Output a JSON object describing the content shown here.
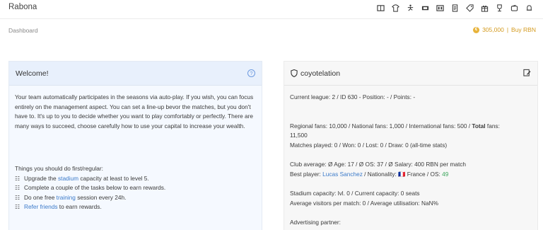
{
  "header": {
    "brand": "Rabona",
    "icons": [
      "scoreboard-icon",
      "shirt-icon",
      "kick-icon",
      "ticket-icon",
      "film-icon",
      "document-icon",
      "tag-icon",
      "gift-icon",
      "trophy-icon",
      "wallet-icon",
      "bell-icon"
    ]
  },
  "subbar": {
    "breadcrumb": "Dashboard",
    "coin_symbol": "€",
    "balance": "305,000",
    "separator": "|",
    "buy_link": "Buy RBN"
  },
  "welcome": {
    "title": "Welcome!",
    "help_symbol": "?",
    "intro": "Your team automatically participates in the seasons via auto-play. If you wish, you can focus entirely on the management aspect. You can set a line-up bevor the matches, but you don't have to. It's up to you to decide whether you want to play comfortably or perfectly. There are many ways to succeed, choose carefully how to use your capital to increase your wealth.",
    "tasks_heading": "Things you should do first/regular:",
    "task_symbol": "☷",
    "tasks": [
      {
        "before": "Upgrade the ",
        "link": "stadium",
        "after": " capacity at least to level 5."
      },
      {
        "before": "Complete a couple of the tasks below to earn rewards.",
        "link": "",
        "after": ""
      },
      {
        "before": "Do one free ",
        "link": "training",
        "after": " session every 24h."
      },
      {
        "before": "",
        "link": "Refer friends",
        "after": " to earn rewards."
      }
    ]
  },
  "club": {
    "name": "coyotelation",
    "league_line": "Current league: 2 / ID 630 - Position: - / Points: -",
    "fans_part1": "Regional fans: 10,000 / National fans: 1,000 / International fans: 500 / ",
    "fans_total_label": "Total",
    "fans_part2": " fans:",
    "fans_total_value": "11,500",
    "matches_line": "Matches played: 0 / Won: 0 / Lost: 0 / Draw: 0 (all-time stats)",
    "club_average": "Club average: Ø Age: 17 / Ø OS: 37 / Ø Salary: 400 RBN per match",
    "best_player_label": "Best player: ",
    "best_player_name": "Lucas Sanchez",
    "nationality_label": " / Nationality: ",
    "flag": "🇫🇷",
    "nationality": " France / OS: ",
    "os_value": "49",
    "stadium_line": "Stadium capacity: lvl. 0 / Current capacity: 0 seats",
    "visitors_line": "Average visitors per match: 0 / Average utilisation: NaN%",
    "advertising_line": "Advertising partner:"
  },
  "colors": {
    "accent": "#3b7ac9",
    "gold": "#d49a1e",
    "welcome_bg": "#f5f9ff",
    "club_bg": "#f7f7f7"
  }
}
